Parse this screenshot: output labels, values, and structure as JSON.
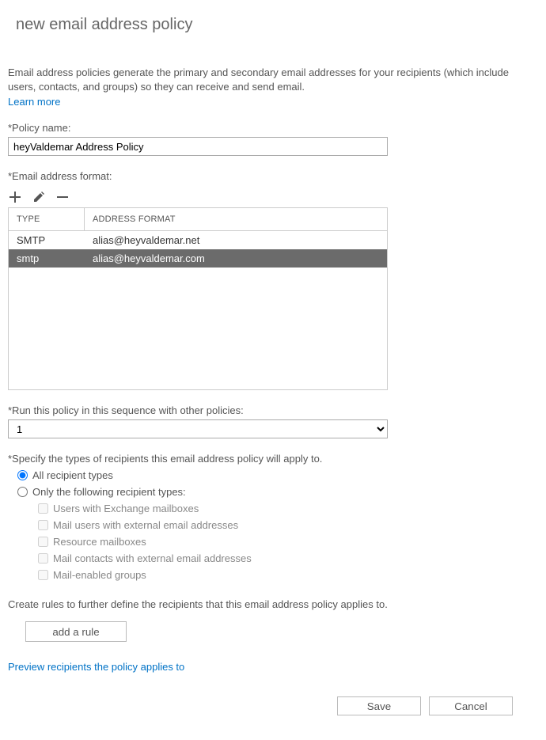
{
  "title": "new email address policy",
  "intro": "Email address policies generate the primary and secondary email addresses for your recipients (which include users, contacts, and groups) so they can receive and send email.",
  "learn_more": "Learn more",
  "labels": {
    "policy_name": "*Policy name:",
    "format": "*Email address format:",
    "sequence": "*Run this policy in this sequence with other policies:",
    "recipients": "*Specify the types of recipients this email address policy will apply to.",
    "rules_intro": "Create rules to further define the recipients that this email address policy applies to."
  },
  "policy_name_value": "heyValdemar Address Policy",
  "table": {
    "header_type": "TYPE",
    "header_format": "ADDRESS FORMAT",
    "rows": [
      {
        "type": "SMTP",
        "format": "alias@heyvaldemar.net",
        "selected": false
      },
      {
        "type": "smtp",
        "format": "alias@heyvaldemar.com",
        "selected": true
      }
    ]
  },
  "sequence_value": "1",
  "radios": {
    "all": "All recipient types",
    "only": "Only the following recipient types:"
  },
  "checks": {
    "exchange": "Users with Exchange mailboxes",
    "mailusers": "Mail users with external email addresses",
    "resource": "Resource mailboxes",
    "contacts": "Mail contacts with external email addresses",
    "groups": "Mail-enabled groups"
  },
  "add_rule": "add a rule",
  "preview": "Preview recipients the policy applies to",
  "buttons": {
    "save": "Save",
    "cancel": "Cancel"
  }
}
